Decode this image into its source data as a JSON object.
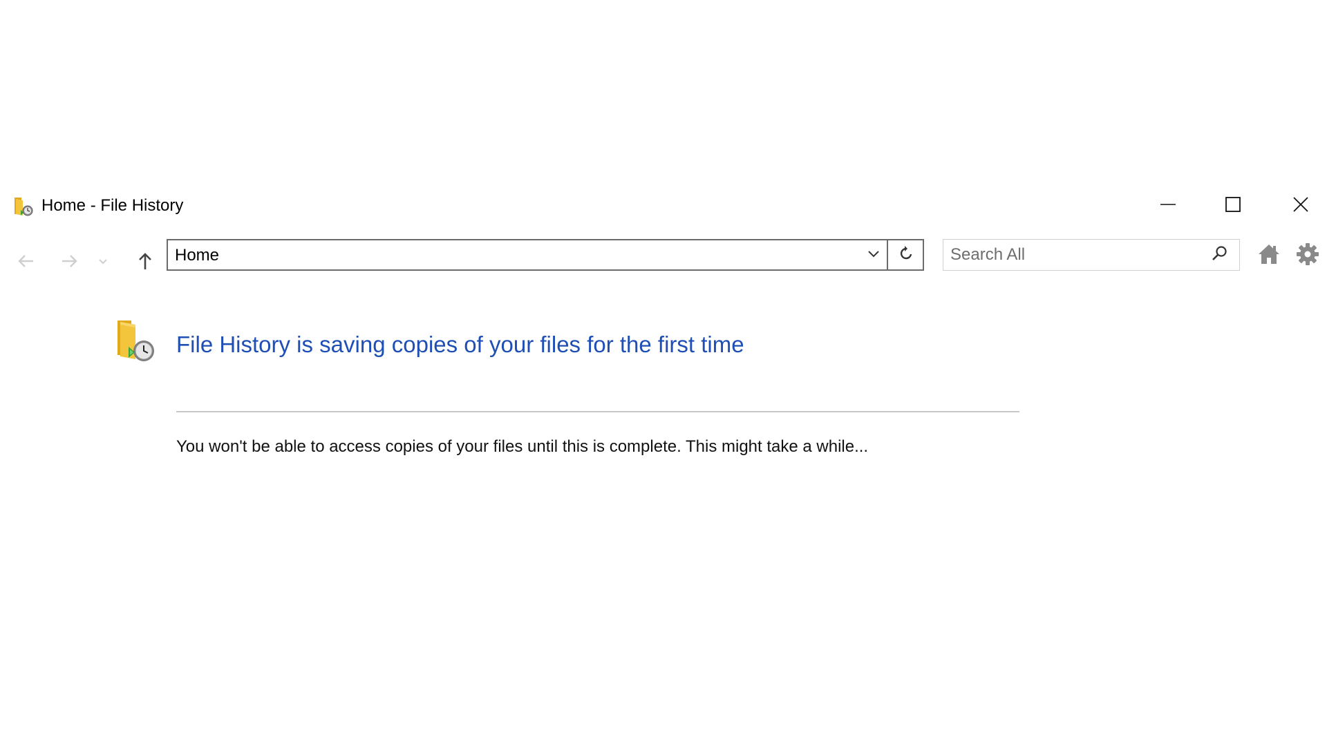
{
  "window": {
    "title": "Home - File History"
  },
  "icons": {
    "app": "file-history-icon",
    "minimize": "minimize-icon",
    "maximize": "maximize-icon",
    "close": "close-icon",
    "back": "arrow-left-icon",
    "forward": "arrow-right-icon",
    "recent": "chevron-down-icon",
    "up": "arrow-up-icon",
    "address_dropdown": "chevron-down-icon",
    "refresh": "refresh-icon",
    "search": "search-icon",
    "home": "home-icon",
    "settings": "gear-icon"
  },
  "address_bar": {
    "value": "Home"
  },
  "search": {
    "placeholder": "Search All",
    "value": ""
  },
  "content": {
    "heading": "File History is saving copies of your files for the first time",
    "message": "You won't be able to access copies of your files until this is complete. This might take a while..."
  },
  "colors": {
    "heading": "#1f4fb4",
    "disabled_icon": "#cfcfcf",
    "folder_yellow": "#f3c53d",
    "badge_green": "#3aa33a"
  }
}
